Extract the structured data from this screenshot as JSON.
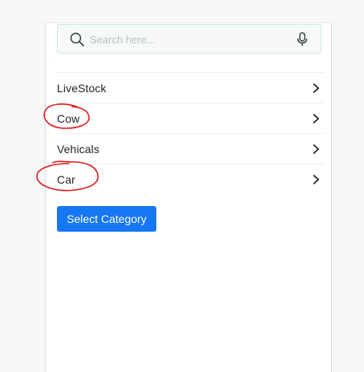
{
  "search": {
    "placeholder": "Search here...",
    "value": "",
    "icon": "search-icon",
    "voice_icon": "microphone-icon"
  },
  "categories": {
    "items": [
      {
        "label": "LiveStock",
        "icon": "chevron-right-icon"
      },
      {
        "label": "Cow",
        "icon": "chevron-right-icon",
        "circled": true
      },
      {
        "label": "Vehicals",
        "icon": "chevron-right-icon"
      },
      {
        "label": "Car",
        "icon": "chevron-right-icon",
        "circled": true
      }
    ]
  },
  "actions": {
    "select_label": "Select Category"
  },
  "colors": {
    "primary_button": "#1677f2",
    "annotation": "#e0191b",
    "search_border": "#cfe8e4"
  }
}
